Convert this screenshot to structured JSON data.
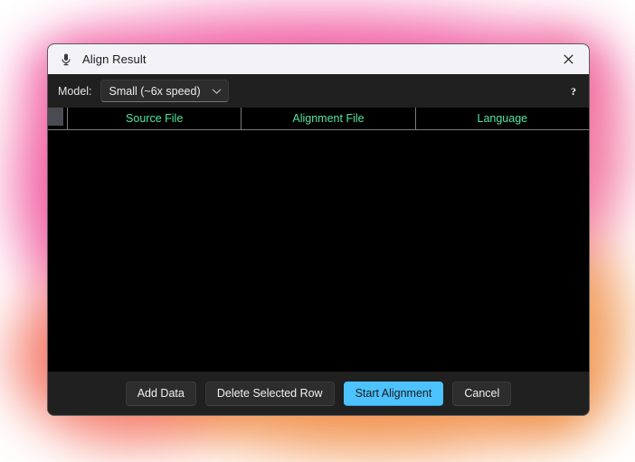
{
  "window": {
    "title": "Align Result",
    "icon": "microphone-icon",
    "close_label": "✕"
  },
  "toolbar": {
    "model_label": "Model:",
    "model_selected": "Small (~6x speed)",
    "model_options": [
      "Small (~6x speed)"
    ],
    "chevron_icon": "chevron-down-icon",
    "help_label": "?"
  },
  "table": {
    "columns": [
      "Source File",
      "Alignment File",
      "Language"
    ],
    "rows": [],
    "header_color": "#54e5a0",
    "body_color": "#000000"
  },
  "footer": {
    "buttons": [
      {
        "label": "Add Data",
        "name": "add-data-button",
        "primary": false
      },
      {
        "label": "Delete Selected Row",
        "name": "delete-selected-row-button",
        "primary": false
      },
      {
        "label": "Start Alignment",
        "name": "start-alignment-button",
        "primary": true
      },
      {
        "label": "Cancel",
        "name": "cancel-button",
        "primary": false
      }
    ],
    "accent_color": "#4cc2ff"
  },
  "theme": {
    "titlebar_bg": "#f3f3f7",
    "window_bg": "#202020",
    "glow_top": "#f0569f",
    "glow_bottom": "#f0873c"
  }
}
